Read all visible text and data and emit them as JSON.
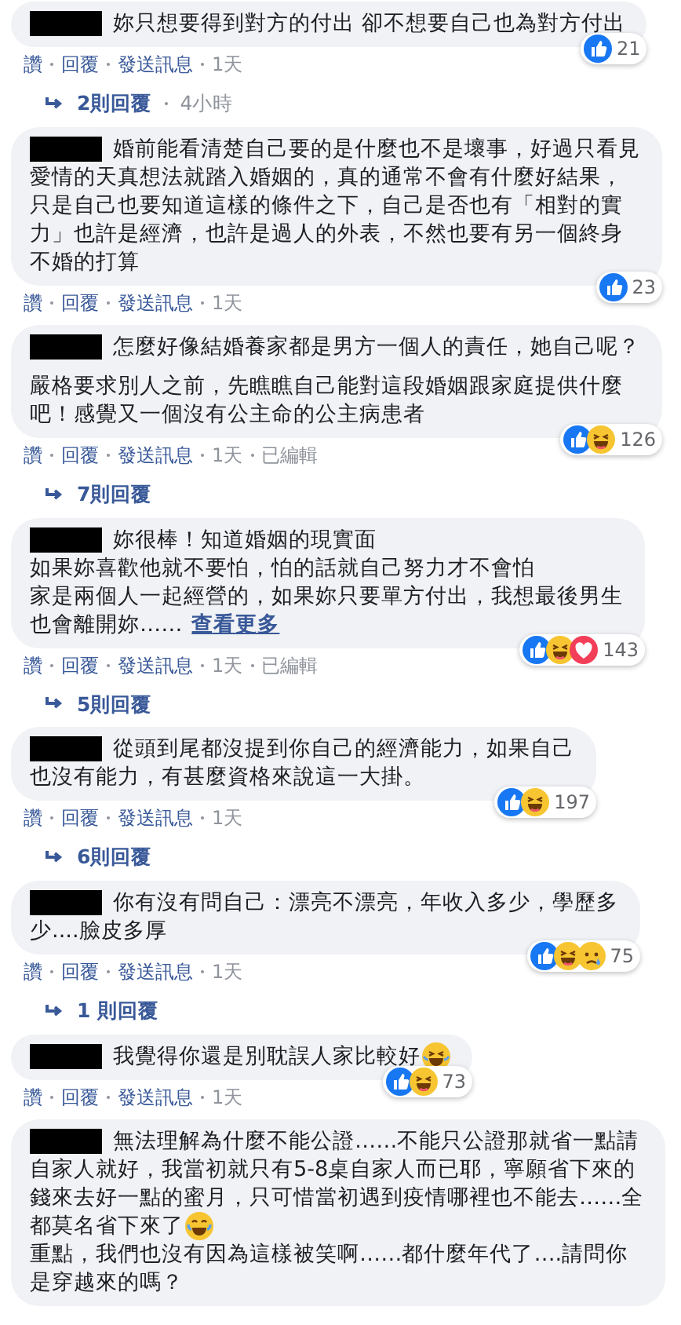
{
  "comments": [
    {
      "paragraphs": [
        [
          {
            "text": "妳只想要得到對方的付出 卻不想要自己也為對方付出"
          }
        ]
      ],
      "reactions": [
        {
          "kind": "like"
        }
      ],
      "reaction_count": "21",
      "actions": [
        "讚",
        "回覆",
        "發送訊息"
      ],
      "time": "1天",
      "replies": {
        "label": "2則回覆",
        "time": "4小時"
      }
    },
    {
      "paragraphs": [
        [
          {
            "text": "婚前能看清楚自己要的是什麼也不是壞事，好過只看見"
          },
          {
            "text": "愛情的天真想法就踏入婚姻的，真的通常不會有什麼好結果，"
          },
          {
            "text": "只是自己也要知道這樣的條件之下，自己是否也有「相對的實"
          },
          {
            "text": "力」也許是經濟，也許是過人的外表，不然也要有另一個終身"
          },
          {
            "text": "不婚的打算"
          }
        ]
      ],
      "reactions": [
        {
          "kind": "like"
        }
      ],
      "reaction_count": "23",
      "actions": [
        "讚",
        "回覆",
        "發送訊息"
      ],
      "time": "1天"
    },
    {
      "paragraphs": [
        [
          {
            "text": "怎麼好像結婚養家都是男方一個人的責任，她自己呢？"
          }
        ],
        [
          {
            "text": "嚴格要求別人之前，先瞧瞧自己能對這段婚姻跟家庭提供什麼"
          },
          {
            "text": "吧！感覺又一個沒有公主命的公主病患者"
          }
        ]
      ],
      "reactions": [
        {
          "kind": "like"
        },
        {
          "kind": "haha"
        }
      ],
      "reaction_count": "126",
      "actions": [
        "讚",
        "回覆",
        "發送訊息"
      ],
      "time": "1天",
      "edited": "已編輯",
      "replies": {
        "label": "7則回覆"
      }
    },
    {
      "paragraphs": [
        [
          {
            "text": "妳很棒！知道婚姻的現實面"
          },
          {
            "text": "如果妳喜歡他就不要怕，怕的話就自己努力才不會怕"
          },
          {
            "text": "家是兩個人一起經營的，如果妳只要單方付出，我想最後男生"
          },
          {
            "text": "也會離開妳……",
            "see_more": "查看更多"
          }
        ]
      ],
      "reactions": [
        {
          "kind": "like"
        },
        {
          "kind": "haha"
        },
        {
          "kind": "love"
        }
      ],
      "reaction_count": "143",
      "actions": [
        "讚",
        "回覆",
        "發送訊息"
      ],
      "time": "1天",
      "edited": "已編輯",
      "replies": {
        "label": "5則回覆"
      }
    },
    {
      "paragraphs": [
        [
          {
            "text": "從頭到尾都沒提到你自己的經濟能力，如果自己"
          },
          {
            "text": "也沒有能力，有甚麼資格來說這一大掛。"
          }
        ]
      ],
      "reactions": [
        {
          "kind": "like"
        },
        {
          "kind": "haha"
        }
      ],
      "reaction_count": "197",
      "actions": [
        "讚",
        "回覆",
        "發送訊息"
      ],
      "time": "1天",
      "replies": {
        "label": "6則回覆"
      }
    },
    {
      "paragraphs": [
        [
          {
            "text": "你有沒有問自己：漂亮不漂亮，年收入多少，學歷多"
          },
          {
            "text": "少....臉皮多厚"
          }
        ]
      ],
      "reactions": [
        {
          "kind": "like"
        },
        {
          "kind": "haha"
        },
        {
          "kind": "sad"
        }
      ],
      "reaction_count": "75",
      "actions": [
        "讚",
        "回覆",
        "發送訊息"
      ],
      "time": "1天",
      "replies": {
        "label": "1 則回覆"
      }
    },
    {
      "paragraphs": [
        [
          {
            "text": "我覺得你還是別耽誤人家比較好",
            "trailing_icon": {
              "kind": "laugh"
            }
          }
        ]
      ],
      "reactions": [
        {
          "kind": "like"
        },
        {
          "kind": "haha"
        }
      ],
      "reaction_count": "73",
      "actions": [
        "讚",
        "回覆",
        "發送訊息"
      ],
      "time": "1天"
    },
    {
      "paragraphs": [
        [
          {
            "text": "無法理解為什麼不能公證……不能只公證那就省一點請"
          },
          {
            "text": "自家人就好，我當初就只有5-8桌自家人而已耶，寧願省下來的"
          },
          {
            "text": "錢來去好一點的蜜月，只可惜當初遇到疫情哪裡也不能去……全"
          },
          {
            "text": "都莫名省下來了",
            "trailing_icon": {
              "kind": "cry-laugh"
            }
          },
          {
            "text": "重點，我們也沒有因為這樣被笑啊……都什麼年代了….請問你"
          },
          {
            "text": "是穿越來的嗎？"
          }
        ]
      ]
    }
  ]
}
